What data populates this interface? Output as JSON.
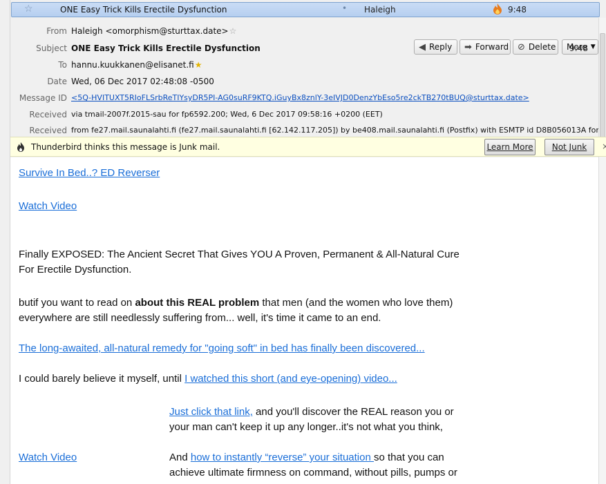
{
  "thread": {
    "subject": "ONE Easy Trick Kills Erectile Dysfunction",
    "sender": "Haleigh",
    "time": "9:48"
  },
  "header": {
    "from_label": "From",
    "from_value": "Haleigh <omorphism@sturttax.date>",
    "subject_label": "Subject",
    "subject_value": "ONE Easy Trick Kills Erectile Dysfunction",
    "to_label": "To",
    "to_value": "hannu.kuukkanen@elisanet.fi",
    "date_label": "Date",
    "date_value": "Wed, 06 Dec 2017 02:48:08 -0500",
    "message_id_label": "Message ID",
    "message_id_value": "<5Q-HVITUXT5RIoFLSrbReTIYsyDR5PI-AG0suRF9KTQ.iGuyBx8znlY-3eIVJD0DenzYbEso5re2ckTB270tBUQ@sturttax.date>",
    "received_label": "Received",
    "received_1": "via tmail-2007f.2015-sau for fp6592.200; Wed, 6 Dec 2017 09:58:16 +0200 (EET)",
    "received_2": "from fe27.mail.saunalahti.fi (fe27.mail.saunalahti.fi [62.142.117.205]) by be408.mail.saunalahti.fi (Postfix) with ESMTP id D8B056013A for",
    "time": "9:48"
  },
  "toolbar": {
    "reply": "Reply",
    "forward": "Forward",
    "delete": "Delete",
    "more": "More"
  },
  "junk": {
    "message": "Thunderbird thinks this message is Junk mail.",
    "learn_more": "Learn More",
    "not_junk": "Not Junk",
    "close": "×"
  },
  "body": {
    "link1": "Survive In Bed..? ED Reverser",
    "link2": "Watch Video",
    "para1_line1": "Finally EXPOSED: The Ancient Secret That Gives YOU A Proven, Permanent & All-Natural Cure",
    "para1_line2": "For Erectile Dysfunction.",
    "para2_pre": "butif you want to read on ",
    "para2_bold": "about this REAL problem",
    "para2_post": " that men (and the women who love them)",
    "para2_line2": "everywhere are still needlessly suffering from... well, it's time it came to an end.",
    "link3": "The long-awaited, all-natural remedy for \"going soft\" in bed has finally been discovered...",
    "para3_pre": "I could barely believe it myself, until ",
    "para3_link": "I watched this short (and eye-opening) video...",
    "para4_link": "Just click that link,",
    "para4_post": " and you'll discover the REAL reason you or",
    "para4_line2": "your man can't keep it up any longer..it's not what you think,",
    "link4": "Watch Video",
    "para5_pre": "And ",
    "para5_link": "how to instantly “reverse” your situation ",
    "para5_post": "so that you can",
    "para5_line2": "achieve ultimate firmness on command, without pills, pumps or"
  }
}
